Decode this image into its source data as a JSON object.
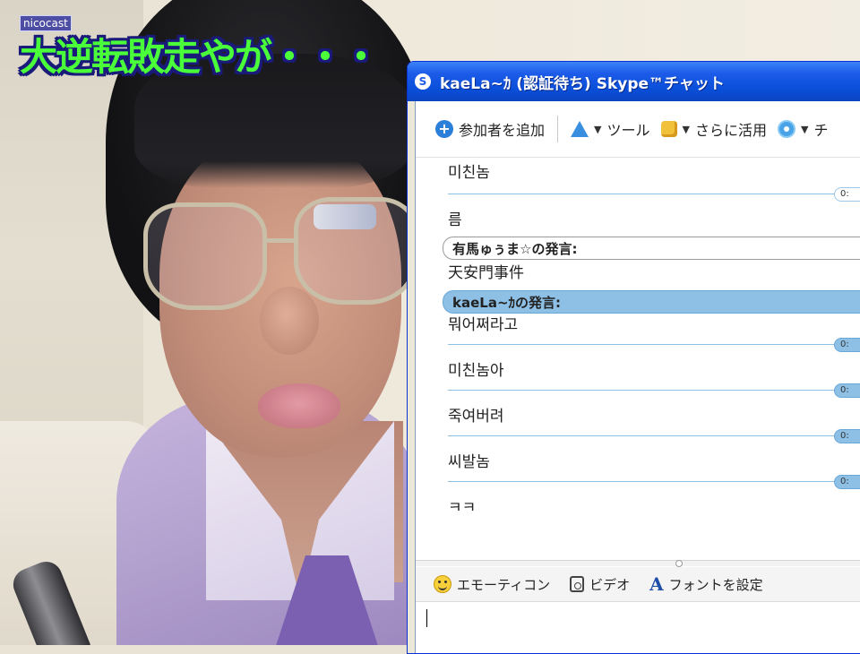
{
  "overlay": {
    "brand": "nicocast",
    "caption": "大逆転敗走やが・・・"
  },
  "window": {
    "title": "kaeLa~ｶ (認証待ち) Skype™チャット"
  },
  "toolbar": {
    "add_participant": "参加者を追加",
    "tools": "ツール",
    "more": "さらに活用",
    "more_truncated": "チ"
  },
  "messages": [
    {
      "kind": "text",
      "text": "미친놈"
    },
    {
      "kind": "text",
      "text": "름"
    },
    {
      "kind": "speaker",
      "text": "有馬ゅぅま☆の発言:",
      "time": "0:"
    },
    {
      "kind": "text",
      "text": "天安門事件"
    },
    {
      "kind": "speaker",
      "text": "kaeLa~ｶの発言:",
      "time": "0:"
    },
    {
      "kind": "text",
      "text": "뭐어쩌라고"
    },
    {
      "kind": "text",
      "text": "미친놈아"
    },
    {
      "kind": "text",
      "text": "죽여버려"
    },
    {
      "kind": "text",
      "text": "씨발놈"
    },
    {
      "kind": "text",
      "text": "ㅋㅋ"
    }
  ],
  "timestamps": {
    "t1": "0:",
    "t2": "0:",
    "t3": "0:",
    "t4": "0:",
    "t5": "0:"
  },
  "input_bar": {
    "emoticons": "エモーティコン",
    "video": "ビデオ",
    "font": "フォントを設定",
    "font_icon": "A"
  },
  "compose": {
    "value": "",
    "cursor": "I"
  }
}
